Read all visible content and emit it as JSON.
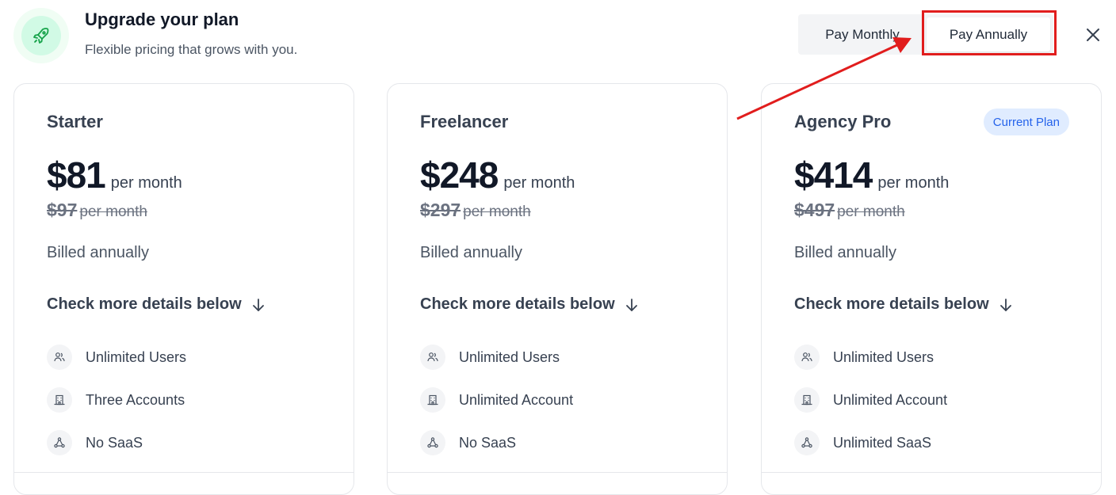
{
  "header": {
    "title": "Upgrade your plan",
    "subtitle": "Flexible pricing that grows with you.",
    "logo_icon": "rocket-icon",
    "accent_color": "#16a34a"
  },
  "billing_toggle": {
    "options": [
      "Pay Monthly",
      "Pay Annually"
    ],
    "selected": "Pay Annually"
  },
  "close_icon": "close-icon",
  "annotation": {
    "color": "#e11d1d"
  },
  "plans": [
    {
      "name": "Starter",
      "price": "$81",
      "period": "per month",
      "old_price": "$97",
      "old_period": "per month",
      "billing_note": "Billed annually",
      "details_link": "Check more details below",
      "badge": "",
      "features": [
        {
          "icon": "users-icon",
          "label": "Unlimited Users"
        },
        {
          "icon": "building-icon",
          "label": "Three Accounts"
        },
        {
          "icon": "network-icon",
          "label": "No SaaS"
        }
      ]
    },
    {
      "name": "Freelancer",
      "price": "$248",
      "period": "per month",
      "old_price": "$297",
      "old_period": "per month",
      "billing_note": "Billed annually",
      "details_link": "Check more details below",
      "badge": "",
      "features": [
        {
          "icon": "users-icon",
          "label": "Unlimited Users"
        },
        {
          "icon": "building-icon",
          "label": "Unlimited Account"
        },
        {
          "icon": "network-icon",
          "label": "No SaaS"
        }
      ]
    },
    {
      "name": "Agency Pro",
      "price": "$414",
      "period": "per month",
      "old_price": "$497",
      "old_period": "per month",
      "billing_note": "Billed annually",
      "details_link": "Check more details below",
      "badge": "Current Plan",
      "features": [
        {
          "icon": "users-icon",
          "label": "Unlimited Users"
        },
        {
          "icon": "building-icon",
          "label": "Unlimited Account"
        },
        {
          "icon": "network-icon",
          "label": "Unlimited SaaS"
        }
      ]
    }
  ]
}
